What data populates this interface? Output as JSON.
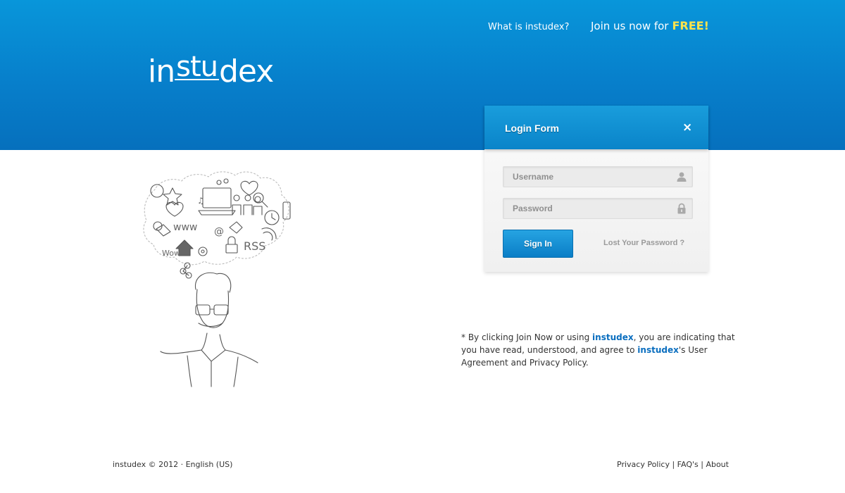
{
  "header": {
    "logo_prefix": "in",
    "logo_mid": "stu",
    "logo_suffix": "dex",
    "nav_what": "What is instudex?",
    "join_text": "Join us now for",
    "join_free": "FREE!"
  },
  "login": {
    "title": "Login Form",
    "close_symbol": "×",
    "username_placeholder": "Username",
    "password_placeholder": "Password",
    "username_icon": "user-icon",
    "password_icon": "lock-icon",
    "signin_label": "Sign In",
    "lost_password": "Lost Your Password ?"
  },
  "terms": {
    "part1": "* By clicking Join Now or using ",
    "brand1": "instudex",
    "part2": ", you are indicating that you have read, understood, and agree to ",
    "brand2": "instudex",
    "part3": "'s User Agreement and Privacy Policy."
  },
  "footer": {
    "copyright": "instudex © 2012 · English (US)",
    "privacy": "Privacy Policy",
    "sep1": " | ",
    "faqs": "FAQ's",
    "sep2": " | ",
    "about": "About"
  },
  "colors": {
    "header_blue": "#077fcb",
    "free_yellow": "#ffe34c",
    "link_blue": "#0a6ebf"
  }
}
